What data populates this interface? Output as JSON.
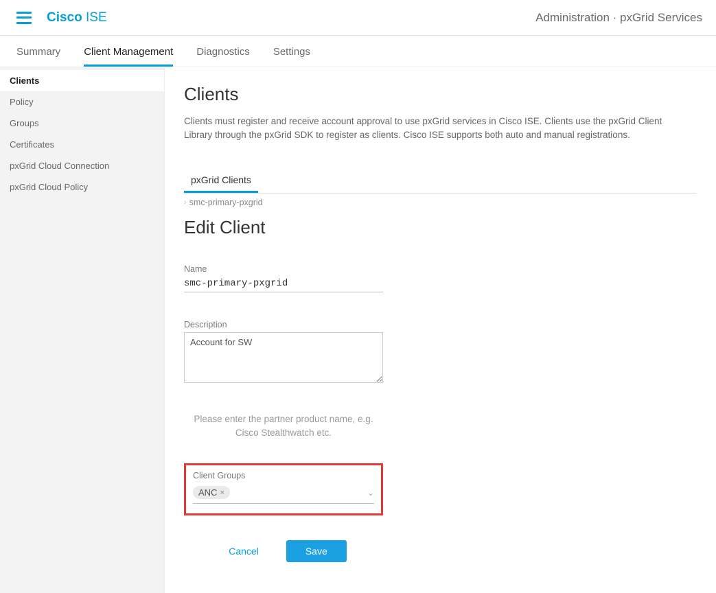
{
  "header": {
    "brand_cisco": "Cisco",
    "brand_ise": " ISE",
    "breadcrumb": "Administration · pxGrid Services"
  },
  "tabs": {
    "items": [
      {
        "label": "Summary"
      },
      {
        "label": "Client Management"
      },
      {
        "label": "Diagnostics"
      },
      {
        "label": "Settings"
      }
    ]
  },
  "sidebar": {
    "items": [
      {
        "label": "Clients"
      },
      {
        "label": "Policy"
      },
      {
        "label": "Groups"
      },
      {
        "label": "Certificates"
      },
      {
        "label": "pxGrid Cloud Connection"
      },
      {
        "label": "pxGrid Cloud Policy"
      }
    ]
  },
  "page": {
    "title": "Clients",
    "description": "Clients must register and receive account approval to use pxGrid services in Cisco ISE. Clients use the pxGrid Client Library through the pxGrid SDK to register as clients. Cisco ISE supports both auto and manual registrations.",
    "sub_tab": "pxGrid Clients",
    "crumb_item": "smc-primary-pxgrid",
    "form_title": "Edit Client"
  },
  "form": {
    "name_label": "Name",
    "name_value": "smc-primary-pxgrid",
    "desc_label": "Description",
    "desc_value": "Account for SW",
    "hint": "Please enter the partner product name, e.g. Cisco Stealthwatch etc.",
    "groups_label": "Client Groups",
    "chip": "ANC",
    "chip_close": "×"
  },
  "actions": {
    "cancel": "Cancel",
    "save": "Save"
  }
}
